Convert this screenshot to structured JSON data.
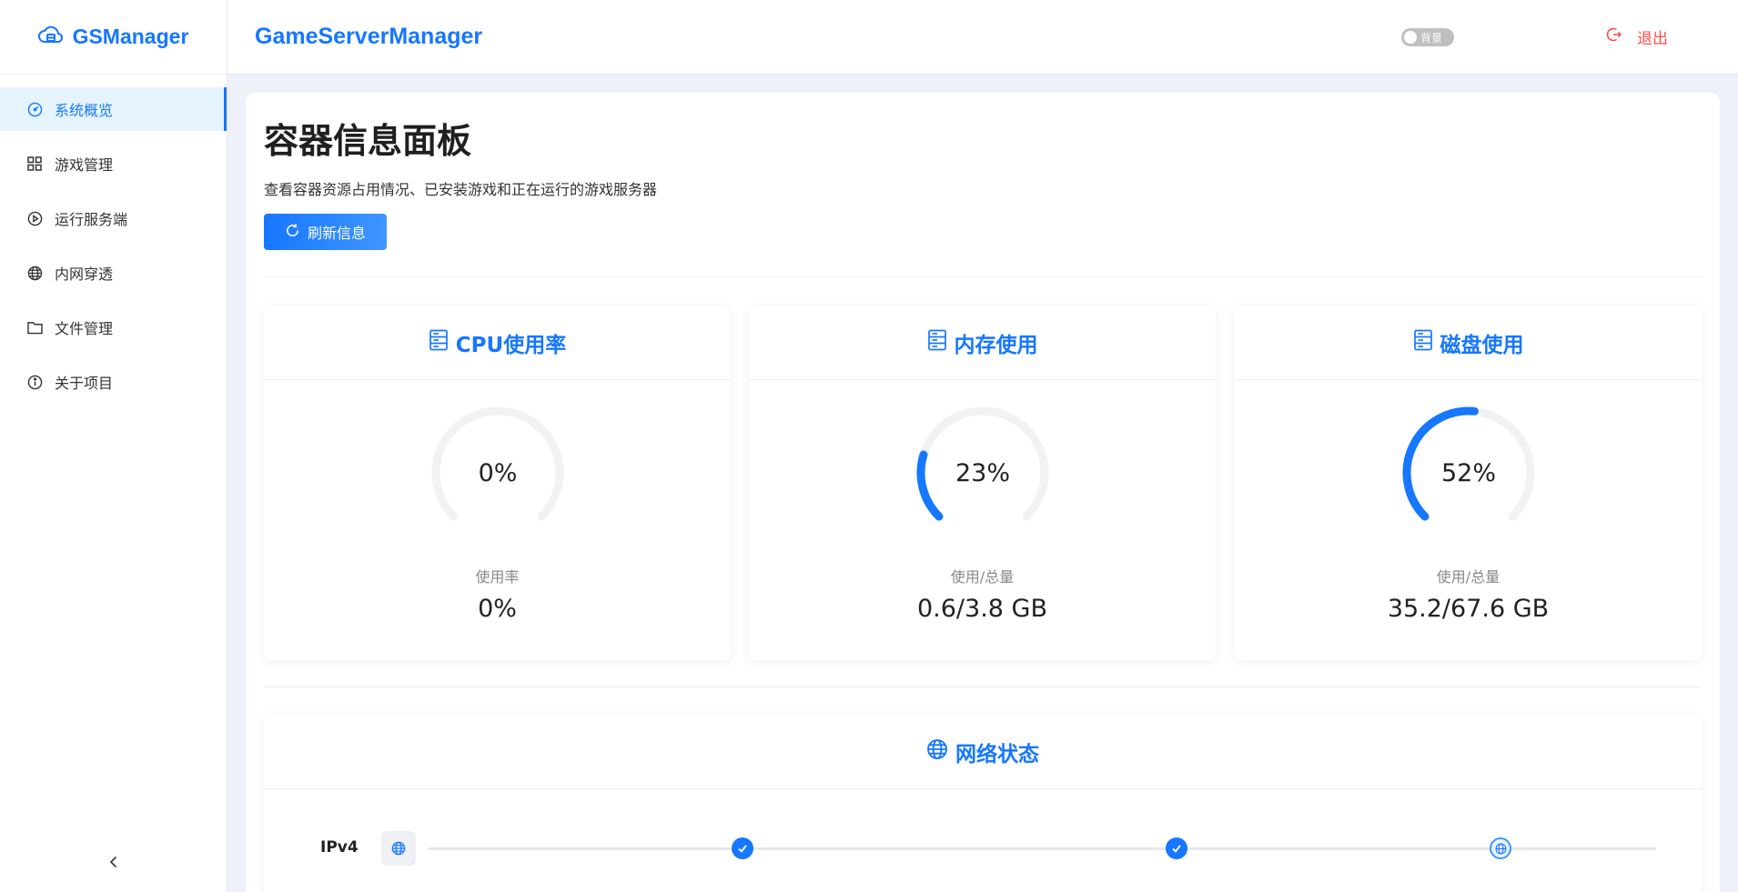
{
  "app": {
    "logo_text": "GSManager",
    "header_title": "GameServerManager",
    "bg_toggle_label": "背景",
    "logout_label": "退出"
  },
  "sidebar": {
    "items": [
      {
        "label": "系统概览",
        "icon": "dashboard-icon",
        "active": true
      },
      {
        "label": "游戏管理",
        "icon": "grid-icon",
        "active": false
      },
      {
        "label": "运行服务端",
        "icon": "play-circle-icon",
        "active": false
      },
      {
        "label": "内网穿透",
        "icon": "globe-icon",
        "active": false
      },
      {
        "label": "文件管理",
        "icon": "folder-icon",
        "active": false
      },
      {
        "label": "关于项目",
        "icon": "info-icon",
        "active": false
      }
    ],
    "collapse_icon": "chevron-left-icon"
  },
  "main": {
    "title": "容器信息面板",
    "description": "查看容器资源占用情况、已安装游戏和正在运行的游戏服务器",
    "refresh_label": "刷新信息"
  },
  "stats": {
    "cpu": {
      "title": "CPU使用率",
      "percent_text": "0%",
      "percent": 0,
      "label": "使用率",
      "value": "0%"
    },
    "memory": {
      "title": "内存使用",
      "percent_text": "23%",
      "percent": 23,
      "label": "使用/总量",
      "value": "0.6/3.8 GB"
    },
    "disk": {
      "title": "磁盘使用",
      "percent_text": "52%",
      "percent": 52,
      "label": "使用/总量",
      "value": "35.2/67.6 GB"
    }
  },
  "network": {
    "title": "网络状态",
    "ipv4_label": "IPv4",
    "checks": 2
  },
  "colors": {
    "accent": "#1677ff",
    "danger": "#ff4d4f",
    "track": "#f2f2f2"
  }
}
